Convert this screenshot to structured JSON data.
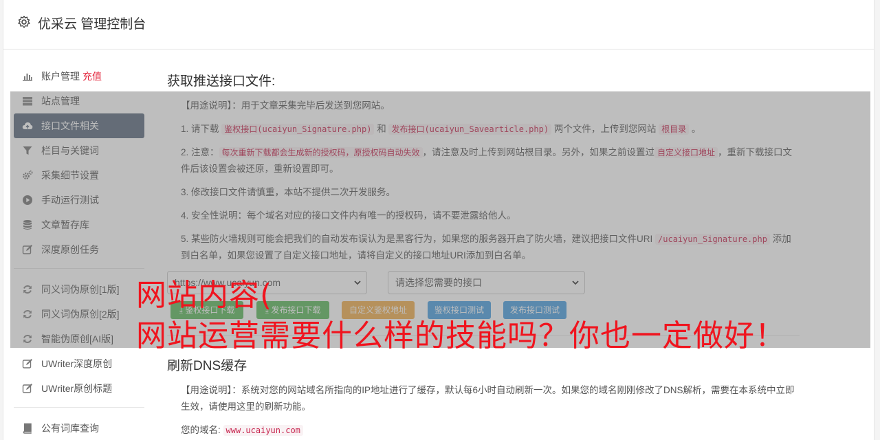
{
  "header": {
    "title": "优采云 管理控制台"
  },
  "sidebar": {
    "group1": [
      {
        "label": "账户管理",
        "extra": "充值",
        "icon": "bar-chart-icon"
      },
      {
        "label": "站点管理",
        "icon": "server-icon"
      },
      {
        "label": "接口文件相关",
        "icon": "cloud-upload-icon",
        "active": true
      },
      {
        "label": "栏目与关键词",
        "icon": "filter-icon"
      },
      {
        "label": "采集细节设置",
        "icon": "gears-icon"
      },
      {
        "label": "手动运行测试",
        "icon": "play-circle-icon"
      },
      {
        "label": "文章暂存库",
        "icon": "database-icon"
      },
      {
        "label": "深度原创任务",
        "icon": "edit-icon"
      }
    ],
    "group2": [
      {
        "label": "同义词伪原创[1版]",
        "icon": "refresh-icon"
      },
      {
        "label": "同义词伪原创[2版]",
        "icon": "refresh-icon"
      },
      {
        "label": "智能伪原创[AI版]",
        "icon": "refresh-icon"
      },
      {
        "label": "UWriter深度原创",
        "icon": "edit-icon"
      },
      {
        "label": "UWriter原创标题",
        "icon": "edit-icon"
      }
    ],
    "group3": [
      {
        "label": "公有词库查询",
        "icon": "book-icon"
      }
    ]
  },
  "section1": {
    "title": "获取推送接口文件:",
    "usage_label": "【用途说明】",
    "usage_text": "：用于文章采集完毕后发送到您网站。",
    "p1_a": "1. 请下载 ",
    "p1_code1": "鉴权接口(ucaiyun_Signature.php)",
    "p1_b": " 和 ",
    "p1_code2": "发布接口(ucaiyun_Savearticle.php)",
    "p1_c": " 两个文件，上传到您网站 ",
    "p1_code3": "根目录",
    "p1_d": " 。",
    "p2_a": "2. 注意：",
    "p2_code1": "每次重新下载都会生成新的授权码，原授权码自动失效",
    "p2_b": "，请注意及时上传到网站根目录。另外，如果之前设置过",
    "p2_code2": "自定义接口地址",
    "p2_c": "，重新下载接口文件后该设置会被还原，重新设置即可。",
    "p3": "3. 修改接口文件请慎重，本站不提供二次开发服务。",
    "p4": "4. 安全性说明：每个域名对应的接口文件内有唯一的授权码，请不要泄露给他人。",
    "p5_a": "5. 某些防火墙规则可能会把我们的自动发布误认为是黑客行为，如果您的服务器开启了防火墙，建议把接口文件URI ",
    "p5_code": "/ucaiyun_Signature.php",
    "p5_b": " 添加到白名单，如果您设置了自定义接口地址，请将自定义的接口地址URI添加到白名单。",
    "select_site": "https://www.ucaiyun.com",
    "select_api": "请选择您需要的接口",
    "buttons": {
      "download_auth": "鉴权接口下载",
      "download_publish": "发布接口下载",
      "custom_auth": "自定义鉴权地址",
      "test_auth": "鉴权接口测试",
      "test_publish": "发布接口测试"
    }
  },
  "section2": {
    "title": "刷新DNS缓存",
    "usage_label": "【用途说明】",
    "usage_text": "：系统对您的网站域名所指向的IP地址进行了缓存，默认每6小时自动刷新一次。如果您的域名刚刚修改了DNS解析，需要在本系统中立即生效，请使用这里的刷新功能。",
    "domain_label": "您的域名:",
    "domain_value": "www.ucaiyun.com"
  },
  "watermark": {
    "line1": "网站内容(",
    "line2": "网站运营需要什么样的技能吗？你也一定做好！"
  },
  "colors": {
    "active_bg": "#5b6b7e",
    "accent_red": "#e3243b",
    "btn_green": "#5cb85c",
    "btn_orange": "#f0ad4e",
    "btn_blue": "#4a9fe0"
  }
}
